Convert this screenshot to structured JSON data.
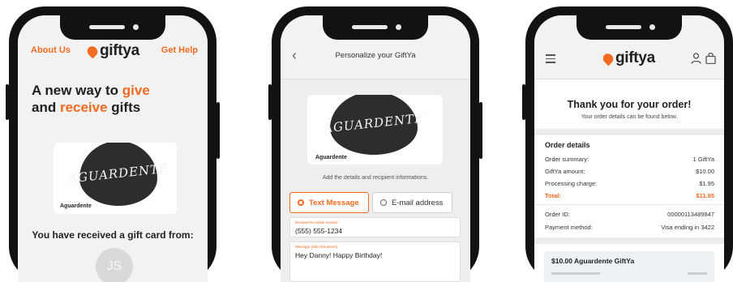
{
  "brand": {
    "name": "giftya",
    "accent": "#f26b21"
  },
  "screen_home": {
    "nav_left": "About Us",
    "nav_right": "Get Help",
    "hero_line1_prefix": "A new way to ",
    "hero_line1_highlight": "give",
    "hero_line2_prefix": "and ",
    "hero_line2_highlight": "receive",
    "hero_line2_suffix": " gifts",
    "card_artwork_text": "AGUARDENTE",
    "card_label": "Aguardente",
    "received_text": "You have received a gift card from:",
    "avatar_initials": "JS"
  },
  "screen_personalize": {
    "title": "Personalize your GiftYa",
    "card_artwork_text": "AGUARDENTE",
    "card_label": "Aguardente",
    "hint": "Add the details and recipient informations.",
    "options": [
      {
        "label": "Text Message",
        "selected": true
      },
      {
        "label": "E-mail address",
        "selected": false
      }
    ],
    "phone_field_label": "Recipient's mobile number",
    "phone_field_value": "(555) 555-1234",
    "message_field_label": "Message (250 characters)",
    "message_field_value": "Hey Danny! Happy Birthday!"
  },
  "screen_confirmation": {
    "title": "Thank you for your order!",
    "subtitle": "Your order details can be found below.",
    "section_title": "Order details",
    "summary_rows": [
      {
        "label": "Order summary:",
        "value": "1 GiftYa"
      },
      {
        "label": "GiftYa amount:",
        "value": "$10.00"
      },
      {
        "label": "Processing charge:",
        "value": "$1.95"
      }
    ],
    "total_label": "Total:",
    "total_value": "$11.95",
    "order_id_label": "Order ID:",
    "order_id_value": "00000113489847",
    "payment_label": "Payment method:",
    "payment_value": "Visa ending in 3422",
    "gift_title": "$10.00 Aguardente GiftYa"
  }
}
